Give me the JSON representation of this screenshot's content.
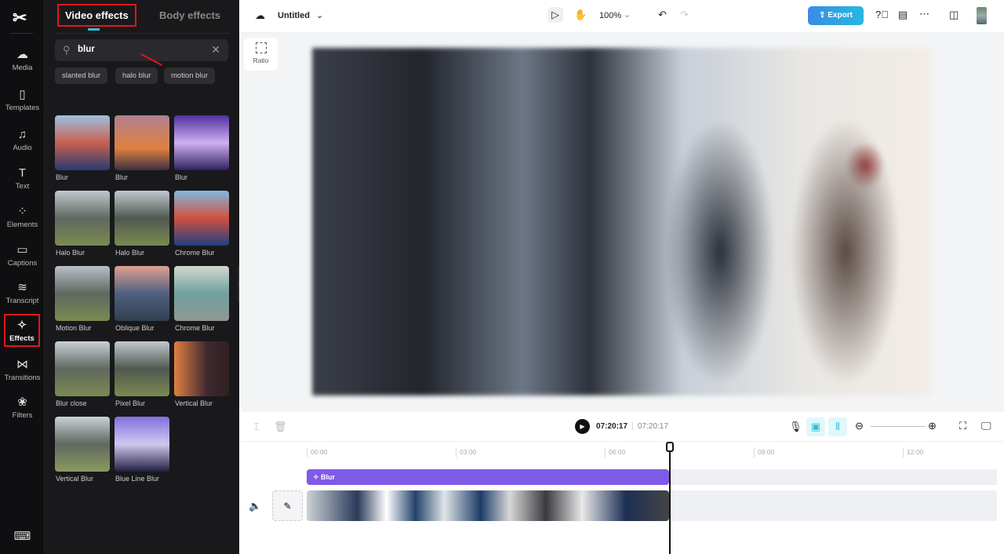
{
  "rail": {
    "items": [
      {
        "label": "Media",
        "icon": "cloud-upload-icon"
      },
      {
        "label": "Templates",
        "icon": "template-icon"
      },
      {
        "label": "Audio",
        "icon": "music-icon"
      },
      {
        "label": "Text",
        "icon": "text-icon"
      },
      {
        "label": "Elements",
        "icon": "elements-icon"
      },
      {
        "label": "Captions",
        "icon": "captions-icon"
      },
      {
        "label": "Transcript",
        "icon": "transcript-icon"
      },
      {
        "label": "Effects",
        "icon": "effects-icon",
        "active": true
      },
      {
        "label": "Transitions",
        "icon": "transitions-icon"
      },
      {
        "label": "Filters",
        "icon": "filters-icon"
      }
    ]
  },
  "panel": {
    "tabs": [
      "Video effects",
      "Body effects"
    ],
    "search": {
      "value": "blur"
    },
    "chips": [
      "slanted blur",
      "halo blur",
      "motion blur"
    ],
    "effects": [
      "Blur",
      "Blur",
      "Blur",
      "Halo Blur",
      "Halo Blur",
      "Chrome Blur",
      "Motion Blur",
      "Oblique Blur",
      "Chrome Blur",
      "Blur close",
      "Pixel Blur",
      "Vertical Blur",
      "Vertical Blur",
      "Blue Line Blur"
    ]
  },
  "topbar": {
    "title": "Untitled",
    "zoom": "100%",
    "export": "Export"
  },
  "canvas": {
    "ratio": "Ratio"
  },
  "timeline": {
    "current": "07:20:17",
    "total": "07:20:17",
    "ticks": [
      "00:00",
      "03:00",
      "06:00",
      "09:00",
      "12:00"
    ],
    "effect_track": "Blur"
  },
  "colors": {
    "accent": "#27c4d8",
    "effect_track": "#7f5ae6",
    "highlight": "#e0161c"
  }
}
